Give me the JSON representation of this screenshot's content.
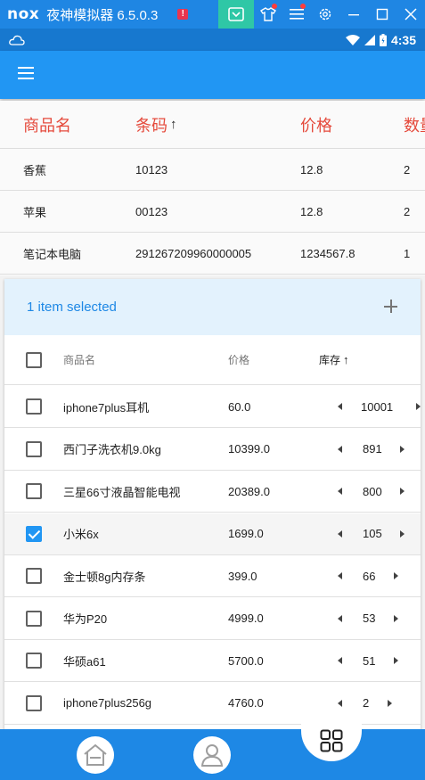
{
  "emulator": {
    "logo": "nox",
    "title": "夜神模拟器 6.5.0.3",
    "alert_glyph": "!"
  },
  "status": {
    "time": "4:35"
  },
  "top_table": {
    "headers": [
      "商品名",
      "条码",
      "价格",
      "数量"
    ],
    "sort_arrow": "↑",
    "rows": [
      [
        "香蕉",
        "10123",
        "12.8",
        "2"
      ],
      [
        "苹果",
        "00123",
        "12.8",
        "2"
      ],
      [
        "笔记本电脑",
        "291267209960000005",
        "1234567.8",
        "1"
      ]
    ]
  },
  "selection": {
    "label": "1 item selected"
  },
  "data_table": {
    "headers": {
      "name": "商品名",
      "price": "价格",
      "stock": "库存",
      "sort_arrow": "↑"
    },
    "rows": [
      {
        "name": "iphone7plus耳机",
        "price": "60.0",
        "stock": "10001",
        "checked": false
      },
      {
        "name": "西门子洗衣机9.0kg",
        "price": "10399.0",
        "stock": "891",
        "checked": false
      },
      {
        "name": "三星66寸液晶智能电视",
        "price": "20389.0",
        "stock": "800",
        "checked": false
      },
      {
        "name": "小米6x",
        "price": "1699.0",
        "stock": "105",
        "checked": true
      },
      {
        "name": "金士顿8g内存条",
        "price": "399.0",
        "stock": "66",
        "checked": false
      },
      {
        "name": "华为P20",
        "price": "4999.0",
        "stock": "53",
        "checked": false
      },
      {
        "name": "华硕a61",
        "price": "5700.0",
        "stock": "51",
        "checked": false
      },
      {
        "name": "iphone7plus256g",
        "price": "4760.0",
        "stock": "2",
        "checked": false
      }
    ]
  },
  "bottom_nav": {
    "items": [
      "home-icon",
      "user-icon",
      "grid-icon"
    ],
    "active": "grid-icon"
  },
  "colors": {
    "app_bar": "#2196f3",
    "header_red": "#e54a3c",
    "selection_bg": "#e3f2fd",
    "selection_text": "#1e88e5"
  }
}
